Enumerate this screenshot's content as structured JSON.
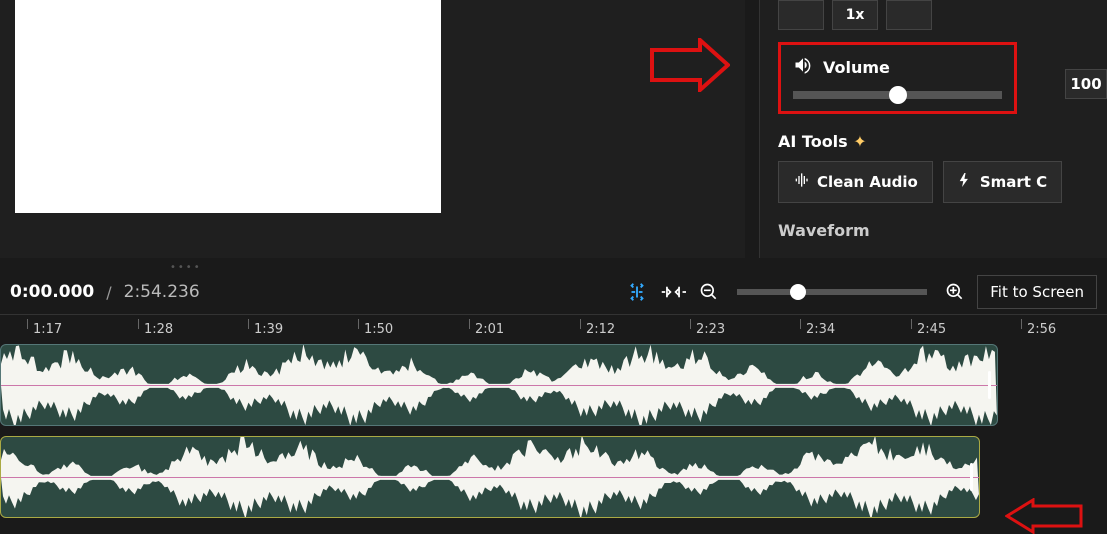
{
  "speed": {
    "value": "1x"
  },
  "volume": {
    "label": "Volume",
    "value": "100"
  },
  "ai": {
    "title": "AI Tools",
    "btn1": "Clean Audio",
    "btn2": "Smart C"
  },
  "waveform": {
    "title": "Waveform"
  },
  "timebar": {
    "current": "0:00.000",
    "total": "2:54.236",
    "fit": "Fit to Screen"
  },
  "ruler": [
    {
      "pos": 27,
      "label": "1:17"
    },
    {
      "pos": 138,
      "label": "1:28"
    },
    {
      "pos": 248,
      "label": "1:39"
    },
    {
      "pos": 358,
      "label": "1:50"
    },
    {
      "pos": 469,
      "label": "2:01"
    },
    {
      "pos": 580,
      "label": "2:12"
    },
    {
      "pos": 690,
      "label": "2:23"
    },
    {
      "pos": 800,
      "label": "2:34"
    },
    {
      "pos": 911,
      "label": "2:45"
    },
    {
      "pos": 1021,
      "label": "2:56"
    }
  ]
}
